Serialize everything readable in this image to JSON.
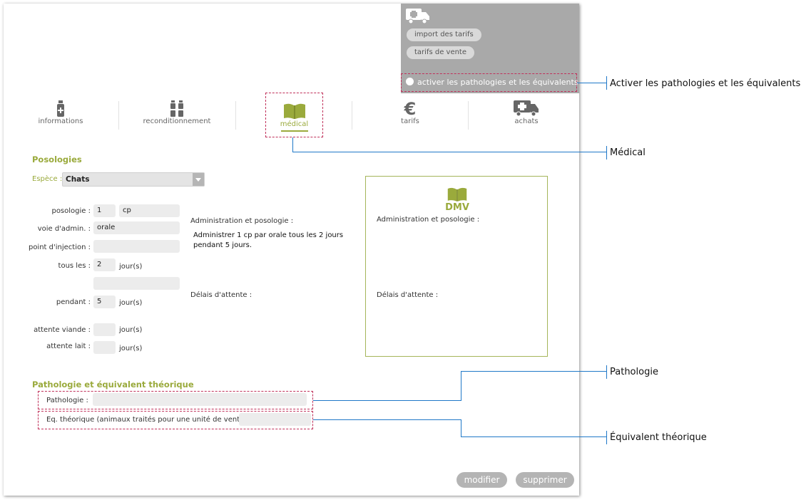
{
  "top_panel": {
    "ambulance_icon": "ambulance-icon",
    "import_button": "import des tarifs",
    "sales_button": "tarifs de vente",
    "activate_label": "activer les pathologies et les équivalents"
  },
  "tabs": [
    {
      "label": "informations",
      "icon": "vial-icon",
      "active": false
    },
    {
      "label": "reconditionnement",
      "icon": "vials-icon",
      "active": false
    },
    {
      "label": "médical",
      "icon": "book-icon",
      "active": true
    },
    {
      "label": "tarifs",
      "icon": "euro-icon",
      "active": false
    },
    {
      "label": "achats",
      "icon": "ambulance-icon",
      "active": false
    }
  ],
  "posologies": {
    "title": "Posologies",
    "espece_label": "Espèce :",
    "espece_value": "Chats",
    "posologie_label": "posologie :",
    "posologie_value": "1",
    "posologie_unit": "cp",
    "voie_label": "voie d'admin. :",
    "voie_value": "orale",
    "injection_label": "point d'injection :",
    "injection_value": "",
    "tous_les_label": "tous les :",
    "tous_les_value": "2",
    "tous_les_unit": "jour(s)",
    "extra_value": "",
    "pendant_label": "pendant :",
    "pendant_value": "5",
    "pendant_unit": "jour(s)",
    "viande_label": "attente viande :",
    "viande_value": "",
    "viande_unit": "jour(s)",
    "lait_label": "attente lait :",
    "lait_value": "",
    "lait_unit": "jour(s)"
  },
  "admin": {
    "title": "Administration et posologie :",
    "line1": "Administrer 1 cp par orale tous les 2 jours",
    "line2": "pendant 5 jours.",
    "delais": "Délais d'attente :"
  },
  "dmv": {
    "title": "DMV",
    "admin_label": "Administration et posologie :",
    "delais_label": "Délais d'attente :"
  },
  "pathologie": {
    "title": "Pathologie et équivalent théorique",
    "pathologie_label": "Pathologie :",
    "pathologie_value": "",
    "eq_label": "Eq. théorique (animaux traités pour une unité de vente) :",
    "eq_value": ""
  },
  "actions": {
    "modifier": "modifier",
    "supprimer": "supprimer"
  },
  "annotations": {
    "activer": "Activer les pathologies et les équivalents",
    "medical": "Médical",
    "pathologie": "Pathologie",
    "equivalent": "Équivalent théorique"
  },
  "colors": {
    "accent_green": "#9aaa3c",
    "annotation_blue": "#1f78c8",
    "dash_red": "#c0305a"
  }
}
